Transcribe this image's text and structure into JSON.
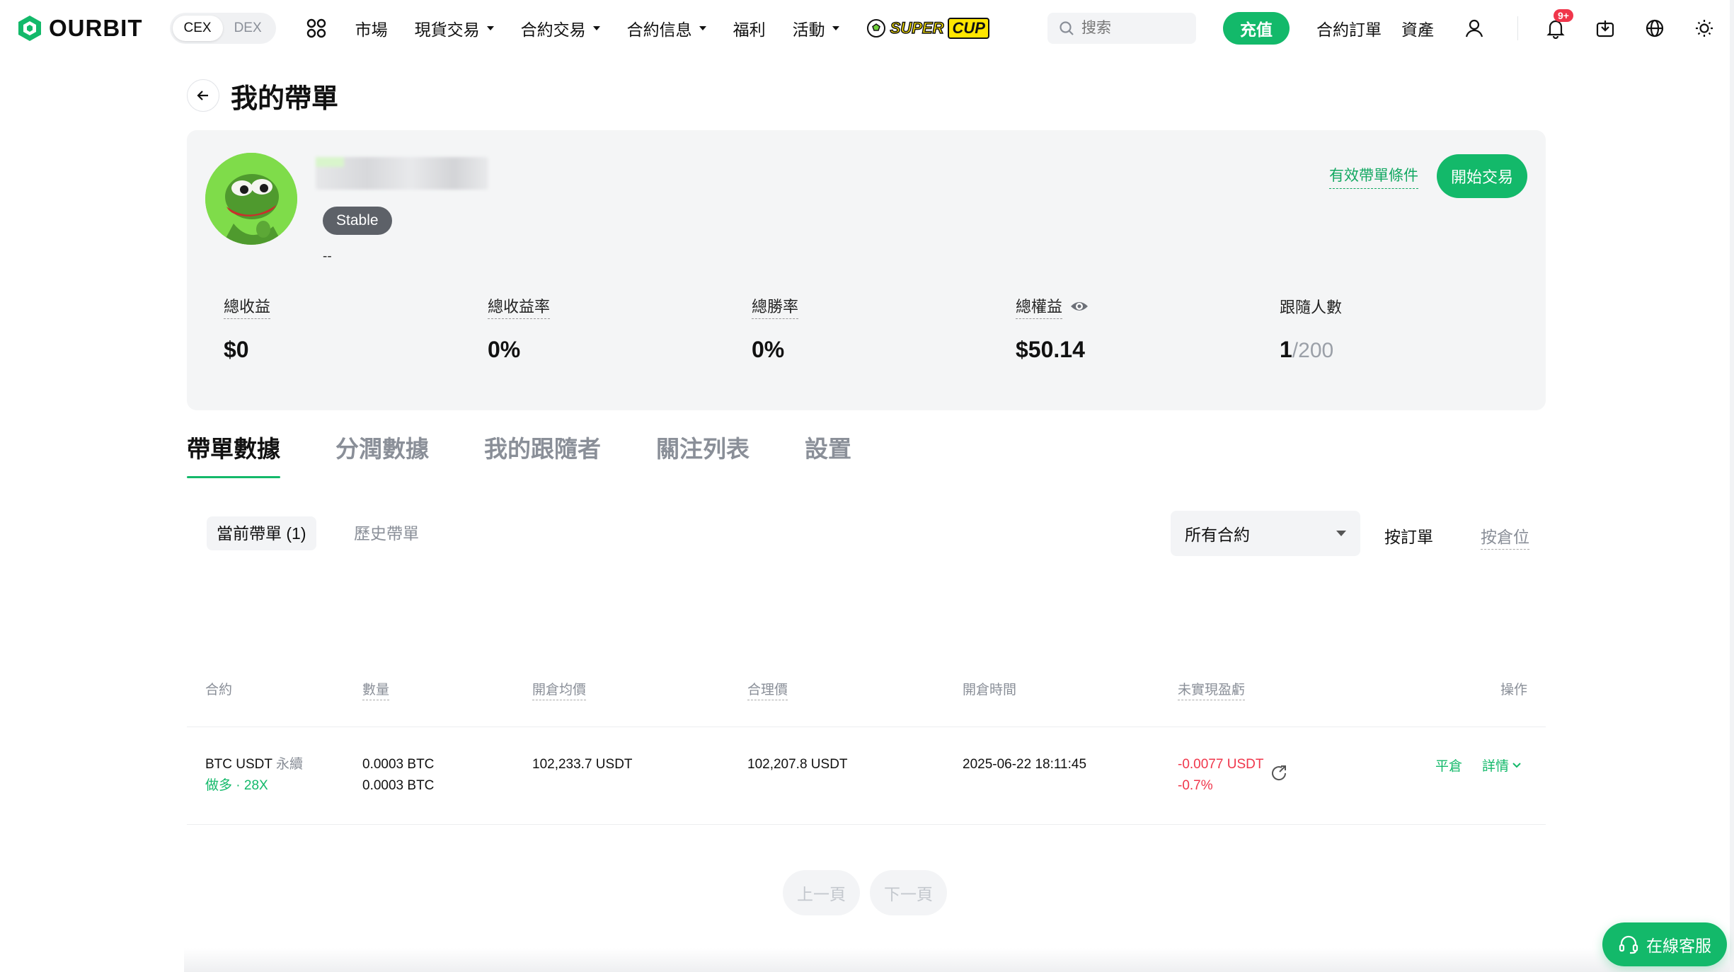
{
  "nav": {
    "logo_text": "OURBIT",
    "segment": [
      "CEX",
      "DEX"
    ],
    "menu": [
      {
        "label": "市場",
        "caret": false
      },
      {
        "label": "現貨交易",
        "caret": true
      },
      {
        "label": "合約交易",
        "caret": true
      },
      {
        "label": "合約信息",
        "caret": true
      },
      {
        "label": "福利",
        "caret": false
      },
      {
        "label": "活動",
        "caret": true
      }
    ],
    "supercup_a": "SUPER",
    "supercup_b": "CUP",
    "search_placeholder": "搜索",
    "deposit": "充值",
    "futures_orders": "合約訂單",
    "assets": "資產",
    "notification_badge": "9+"
  },
  "page": {
    "title": "我的帶單"
  },
  "profile": {
    "tag": "Stable",
    "bio": "--",
    "conditions_link": "有效帶單條件",
    "start_button": "開始交易",
    "stats": [
      {
        "label": "總收益",
        "value": "$0",
        "suffix": ""
      },
      {
        "label": "總收益率",
        "value": "0%",
        "suffix": ""
      },
      {
        "label": "總勝率",
        "value": "0%",
        "suffix": ""
      },
      {
        "label": "總權益",
        "value": "$50.14",
        "suffix": ""
      },
      {
        "label": "跟隨人數",
        "value": "1",
        "suffix": "/200"
      }
    ]
  },
  "tabs": [
    "帶單數據",
    "分潤數據",
    "我的跟隨者",
    "關注列表",
    "設置"
  ],
  "subtabs": [
    "當前帶單 (1)",
    "歷史帶單"
  ],
  "filter": {
    "selected": "所有合約",
    "view_by_order": "按訂單",
    "view_by_position": "按倉位"
  },
  "table": {
    "headers": [
      "合約",
      "數量",
      "開倉均價",
      "合理價",
      "開倉時間",
      "未實現盈虧",
      "操作"
    ],
    "rows": [
      {
        "symbol": "BTC USDT",
        "contract_type": "永續",
        "side": "做多 · 28X",
        "qty1": "0.0003 BTC",
        "qty2": "0.0003 BTC",
        "entry_price": "102,233.7 USDT",
        "fair_price": "102,207.8 USDT",
        "open_time": "2025-06-22 18:11:45",
        "pnl": "-0.0077 USDT",
        "pnl_pct": "-0.7%",
        "action_close": "平倉",
        "action_detail": "詳情"
      }
    ]
  },
  "pager": {
    "prev": "上一頁",
    "next": "下一頁"
  },
  "support": {
    "label": "在線客服"
  },
  "colors": {
    "brand": "#13b96a",
    "loss": "#f0364b"
  }
}
